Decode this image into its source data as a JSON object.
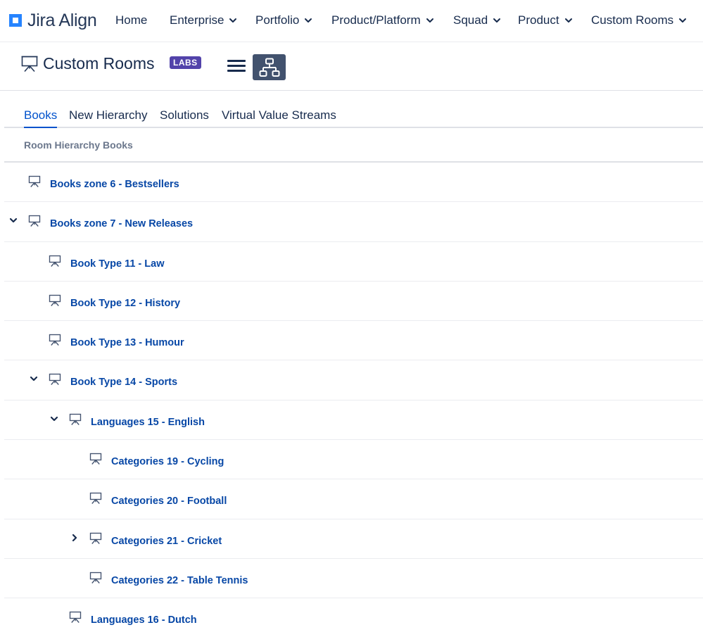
{
  "brand": {
    "name": "Jira Align",
    "accent": "#2684ff"
  },
  "nav": [
    {
      "label": "Home",
      "dropdown": false
    },
    {
      "label": "Enterprise",
      "dropdown": true
    },
    {
      "label": "Portfolio",
      "dropdown": true
    },
    {
      "label": "Product/Platform",
      "dropdown": true
    },
    {
      "label": "Squad",
      "dropdown": true
    },
    {
      "label": "Product",
      "dropdown": true
    },
    {
      "label": "Custom Rooms",
      "dropdown": true
    }
  ],
  "header": {
    "title": "Custom Rooms",
    "badge": "LABS",
    "badge_color": "#5243aa",
    "title_icon": "presentation-board-icon",
    "menu_icon": "hamburger-menu-icon",
    "hierarchy_icon": "hierarchy-icon"
  },
  "tabs": [
    {
      "label": "Books",
      "active": true
    },
    {
      "label": "New Hierarchy",
      "active": false
    },
    {
      "label": "Solutions",
      "active": false
    },
    {
      "label": "Virtual Value Streams",
      "active": false
    }
  ],
  "section_label": "Room Hierarchy Books",
  "tree": [
    {
      "label": "Books zone 6 - Bestsellers",
      "level": 0,
      "toggle": "none"
    },
    {
      "label": "Books zone 7 - New Releases",
      "level": 0,
      "toggle": "expanded"
    },
    {
      "label": "Book Type 11 - Law",
      "level": 1,
      "toggle": "none"
    },
    {
      "label": "Book Type 12 - History",
      "level": 1,
      "toggle": "none"
    },
    {
      "label": "Book Type 13 - Humour",
      "level": 1,
      "toggle": "none"
    },
    {
      "label": "Book Type 14 - Sports",
      "level": 1,
      "toggle": "expanded"
    },
    {
      "label": "Languages 15 - English",
      "level": 2,
      "toggle": "expanded"
    },
    {
      "label": "Categories 19 - Cycling",
      "level": 3,
      "toggle": "none"
    },
    {
      "label": "Categories 20 - Football",
      "level": 3,
      "toggle": "none"
    },
    {
      "label": "Categories 21 - Cricket",
      "level": 3,
      "toggle": "collapsed"
    },
    {
      "label": "Categories 22 - Table Tennis",
      "level": 3,
      "toggle": "none"
    },
    {
      "label": "Languages 16 - Dutch",
      "level": 2,
      "toggle": "none"
    }
  ]
}
